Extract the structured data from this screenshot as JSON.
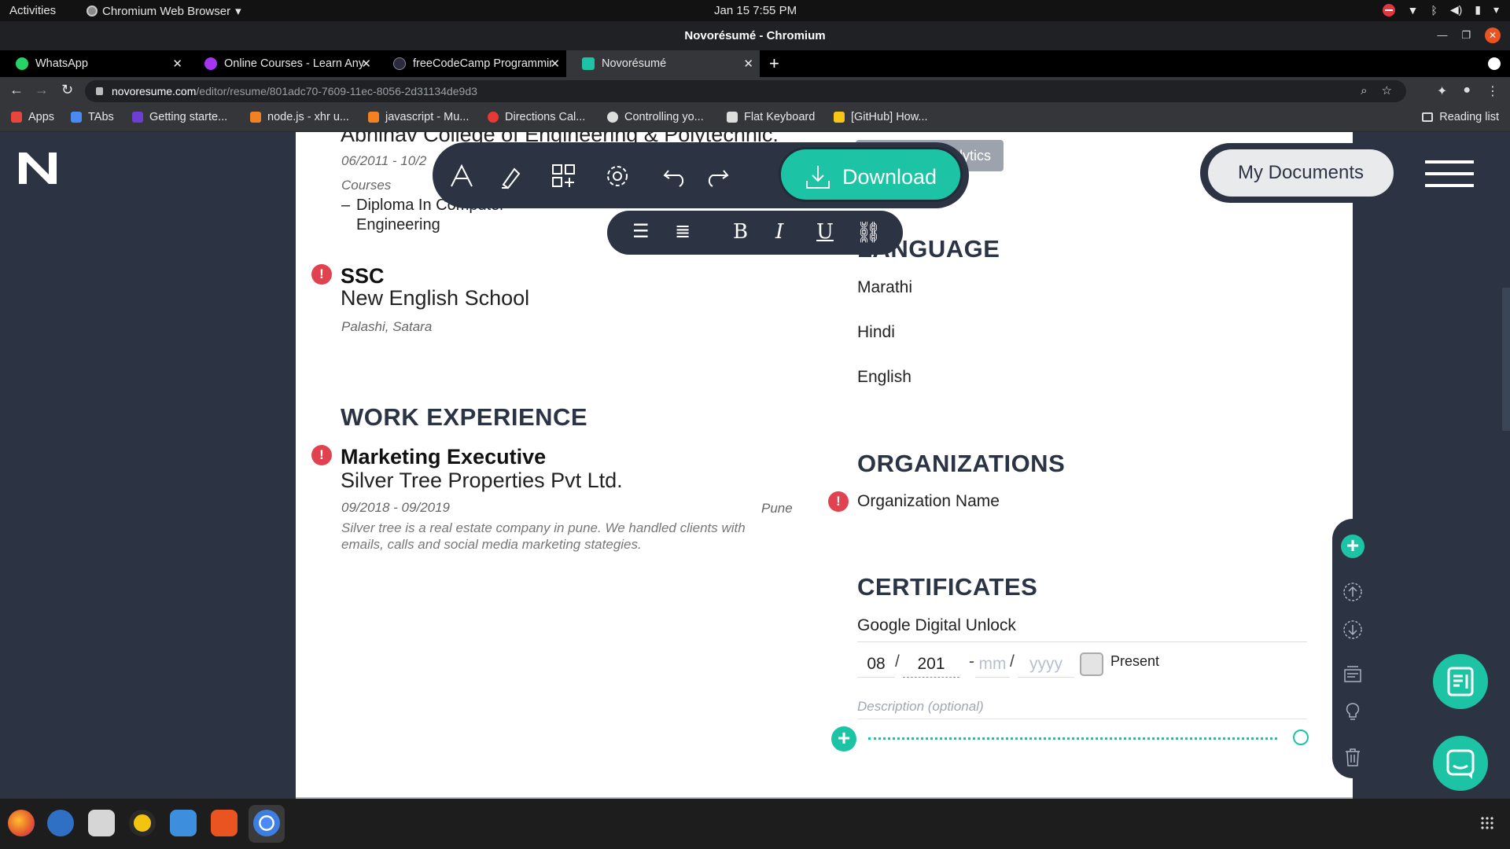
{
  "system": {
    "activities": "Activities",
    "app_name": "Chromium Web Browser",
    "clock": "Jan 15  7:55 PM"
  },
  "window": {
    "title": "Novorésumé - Chromium"
  },
  "tabs": [
    {
      "label": "WhatsApp",
      "icon": "whatsapp-icon",
      "color": "#25d366"
    },
    {
      "label": "Online Courses - Learn Anything",
      "icon": "udemy-icon",
      "color": "#a435f0"
    },
    {
      "label": "freeCodeCamp Programming",
      "icon": "freecodecamp-icon",
      "color": "#2a2a40"
    },
    {
      "label": "Novorésumé",
      "icon": "novoresume-icon",
      "color": "#1cc3a4",
      "active": true
    }
  ],
  "address": {
    "host": "novoresume.com",
    "path": "/editor/resume/801adc70-7609-11ec-8056-2d31134de9d3"
  },
  "bookmarks": [
    {
      "label": "Apps",
      "color": "#e8453c"
    },
    {
      "label": "TAbs",
      "color": "#4a8af4"
    },
    {
      "label": "Getting starte...",
      "color": "#6b3fd4"
    },
    {
      "label": "node.js - xhr u...",
      "color": "#f48024"
    },
    {
      "label": "javascript - Mu...",
      "color": "#f48024"
    },
    {
      "label": "Directions Cal...",
      "color": "#e53935"
    },
    {
      "label": "Controlling yo...",
      "color": "#dddddd"
    },
    {
      "label": "Flat Keyboard",
      "color": "#dddddd"
    },
    {
      "label": "[GitHub] How...",
      "color": "#f5c518"
    }
  ],
  "reading_list": "Reading list",
  "toolbar": {
    "download_label": "Download",
    "my_documents_label": "My Documents",
    "hidden_tooltip": "Analytics"
  },
  "resume": {
    "edu_school_partial": "Abhinav College of Engineering & Polytechnic.",
    "edu_dates_partial": "06/2011 - 10/2",
    "courses_label": "Courses",
    "course_item_line1": "Diploma In Computer",
    "course_item_line2": "Engineering",
    "ssc_title": "SSC",
    "ssc_school": "New English School",
    "ssc_location": "Palashi, Satara",
    "work_heading": "WORK EXPERIENCE",
    "job_title": "Marketing Executive",
    "job_company": "Silver Tree Properties Pvt Ltd.",
    "job_dates": "09/2018 - 09/2019",
    "job_city": "Pune",
    "job_desc": "Silver tree is a real estate company in pune. We handled clients with emails, calls and social media marketing stategies.",
    "language_heading": "LANGUAGE",
    "languages": [
      "Marathi",
      "Hindi",
      "English"
    ],
    "org_heading": "ORGANIZATIONS",
    "org_name": "Organization Name",
    "cert_heading": "CERTIFICATES",
    "cert_name": "Google Digital Unlock",
    "cert_month": "08",
    "cert_year": "201",
    "cert_end_month_ph": "mm",
    "cert_end_year_ph": "yyyy",
    "present_label": "Present",
    "desc_placeholder": "Description (optional)"
  },
  "colors": {
    "accent": "#1cc3a4",
    "dark": "#2c3444",
    "warning": "#e0434f"
  }
}
